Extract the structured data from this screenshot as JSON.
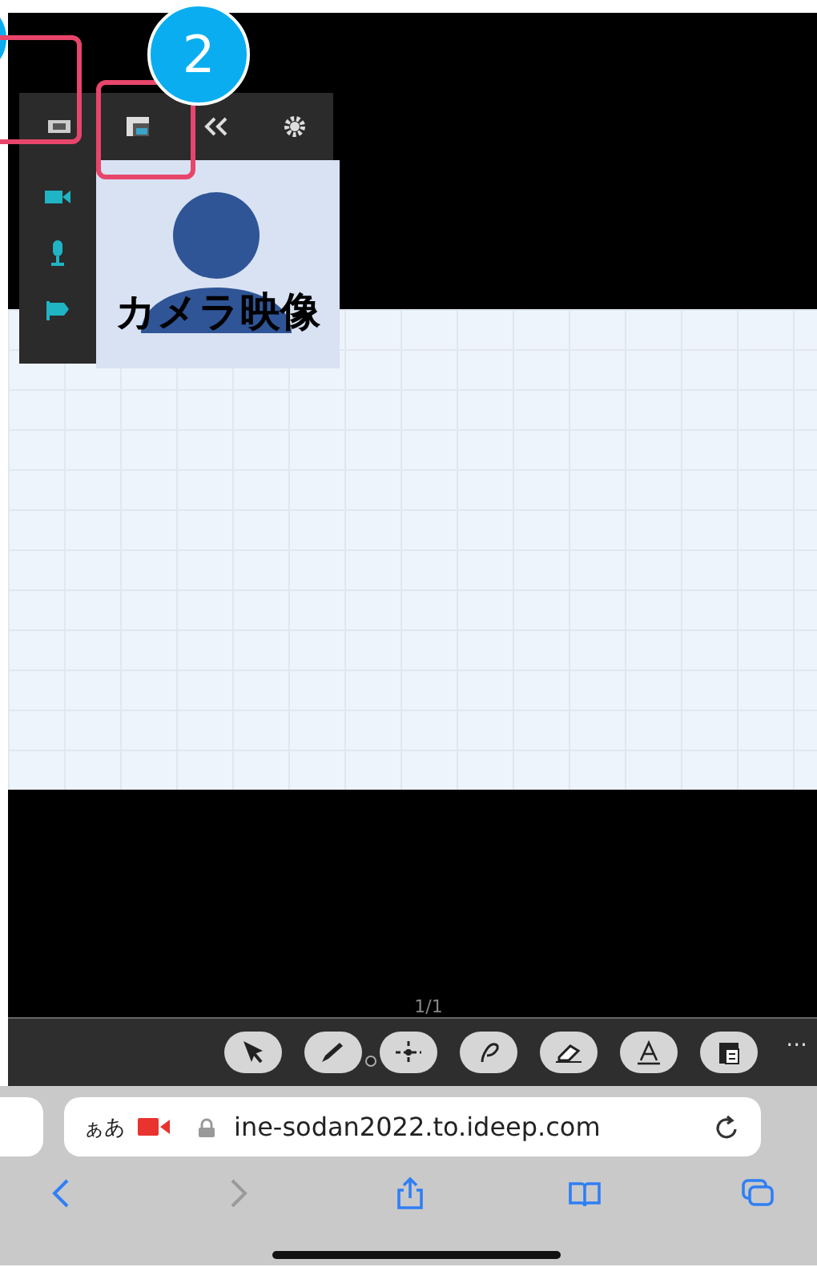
{
  "callout": {
    "number": "2"
  },
  "panel": {
    "top_icons": [
      {
        "kind": "camera-box"
      },
      {
        "kind": "layout"
      },
      {
        "kind": "collapse"
      },
      {
        "kind": "gear"
      }
    ],
    "side_icons": [
      {
        "kind": "camera"
      },
      {
        "kind": "mic"
      },
      {
        "kind": "flag"
      }
    ]
  },
  "camera_tile": {
    "label": "カメラ映像"
  },
  "page_indicator": "1/1",
  "tools": [
    {
      "kind": "select"
    },
    {
      "kind": "pen"
    },
    {
      "kind": "move"
    },
    {
      "kind": "lasso"
    },
    {
      "kind": "eraser"
    },
    {
      "kind": "text"
    },
    {
      "kind": "clipboard"
    }
  ],
  "more": "···",
  "address_bar": {
    "text_size": "ぁあ",
    "url": "ine-sodan2022.to.ideep.com"
  },
  "nav": [
    {
      "kind": "back",
      "disabled": false
    },
    {
      "kind": "forward",
      "disabled": true
    },
    {
      "kind": "share",
      "disabled": false
    },
    {
      "kind": "bookmarks",
      "disabled": false
    },
    {
      "kind": "tabs",
      "disabled": false
    }
  ]
}
